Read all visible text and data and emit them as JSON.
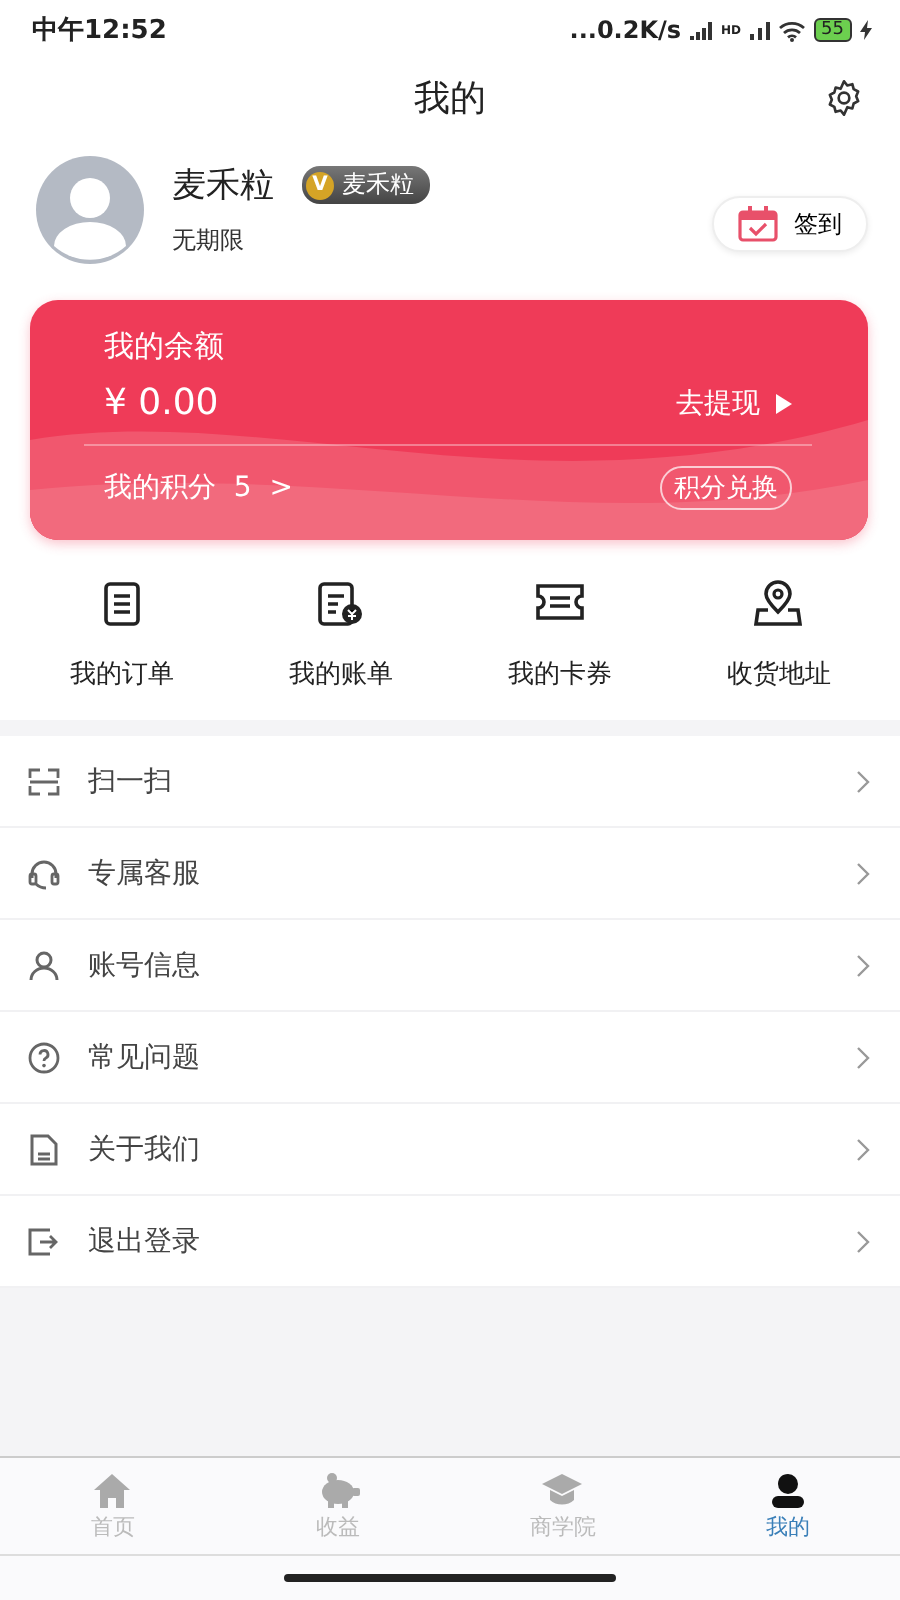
{
  "status_bar": {
    "time": "中午12:52",
    "speed": "...0.2K/s",
    "network_label": "HD",
    "battery": "55"
  },
  "header": {
    "title": "我的"
  },
  "profile": {
    "name": "麦禾粒",
    "badge": "麦禾粒",
    "badge_mark": "V",
    "validity": "无期限",
    "checkin": "签到"
  },
  "wallet": {
    "balance_label": "我的余额",
    "balance": "¥  0.00",
    "withdraw": "去提现",
    "points_label": "我的积分",
    "points": "5",
    "points_arrow": ">",
    "exchange": "积分兑换"
  },
  "shortcuts": [
    {
      "kind": "order",
      "label": "我的订单"
    },
    {
      "kind": "bill",
      "label": "我的账单"
    },
    {
      "kind": "coupon",
      "label": "我的卡券"
    },
    {
      "kind": "address",
      "label": "收货地址"
    }
  ],
  "menu": [
    {
      "kind": "scan",
      "label": "扫一扫"
    },
    {
      "kind": "service",
      "label": "专属客服"
    },
    {
      "kind": "account",
      "label": "账号信息"
    },
    {
      "kind": "faq",
      "label": "常见问题"
    },
    {
      "kind": "about",
      "label": "关于我们"
    },
    {
      "kind": "logout",
      "label": "退出登录"
    }
  ],
  "tabs": [
    {
      "kind": "home",
      "label": "首页",
      "selected": false
    },
    {
      "kind": "income",
      "label": "收益",
      "selected": false
    },
    {
      "kind": "school",
      "label": "商学院",
      "selected": false
    },
    {
      "kind": "mine",
      "label": "我的",
      "selected": true
    }
  ]
}
